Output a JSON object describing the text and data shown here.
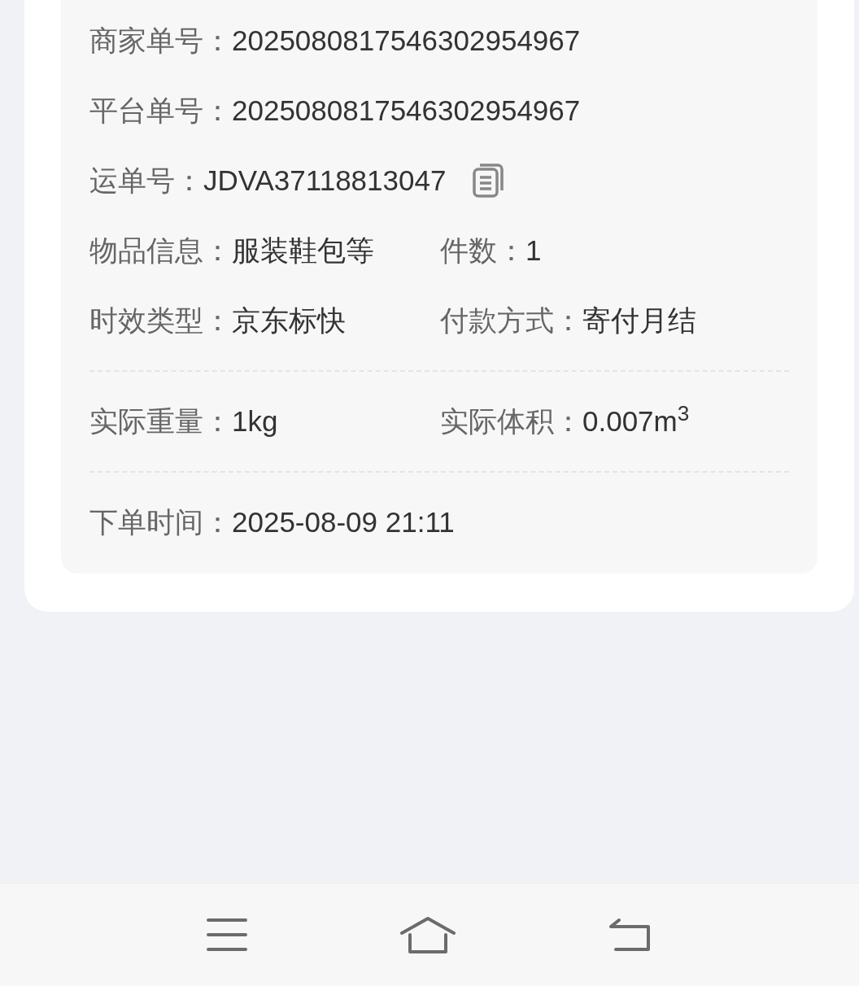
{
  "order_info": {
    "rows": [
      {
        "kind": "fields",
        "items": [
          {
            "label": "商家单号：",
            "value": "2025080817546302954967"
          }
        ]
      },
      {
        "kind": "fields",
        "items": [
          {
            "label": "平台单号：",
            "value": "2025080817546302954967"
          }
        ]
      },
      {
        "kind": "fields",
        "items": [
          {
            "label": "运单号：",
            "value": "JDVA37118813047",
            "copyable": true
          }
        ]
      },
      {
        "kind": "fields",
        "items": [
          {
            "label": "物品信息：",
            "value": "服装鞋包等"
          },
          {
            "label": "件数：",
            "value": "1"
          }
        ]
      },
      {
        "kind": "fields",
        "items": [
          {
            "label": "时效类型：",
            "value": "京东标快"
          },
          {
            "label": "付款方式：",
            "value": "寄付月结"
          }
        ]
      },
      {
        "kind": "divider"
      },
      {
        "kind": "fields",
        "items": [
          {
            "label": "实际重量：",
            "value": "1kg"
          },
          {
            "label": "实际体积：",
            "value": "0.007m$^{3}$"
          }
        ]
      },
      {
        "kind": "divider"
      },
      {
        "kind": "fields",
        "items": [
          {
            "label": "下单时间：",
            "value": "2025-08-09 21:11"
          }
        ]
      }
    ]
  },
  "nav_bar": {
    "buttons": [
      {
        "kind": "menu"
      },
      {
        "kind": "home"
      },
      {
        "kind": "back"
      }
    ]
  }
}
